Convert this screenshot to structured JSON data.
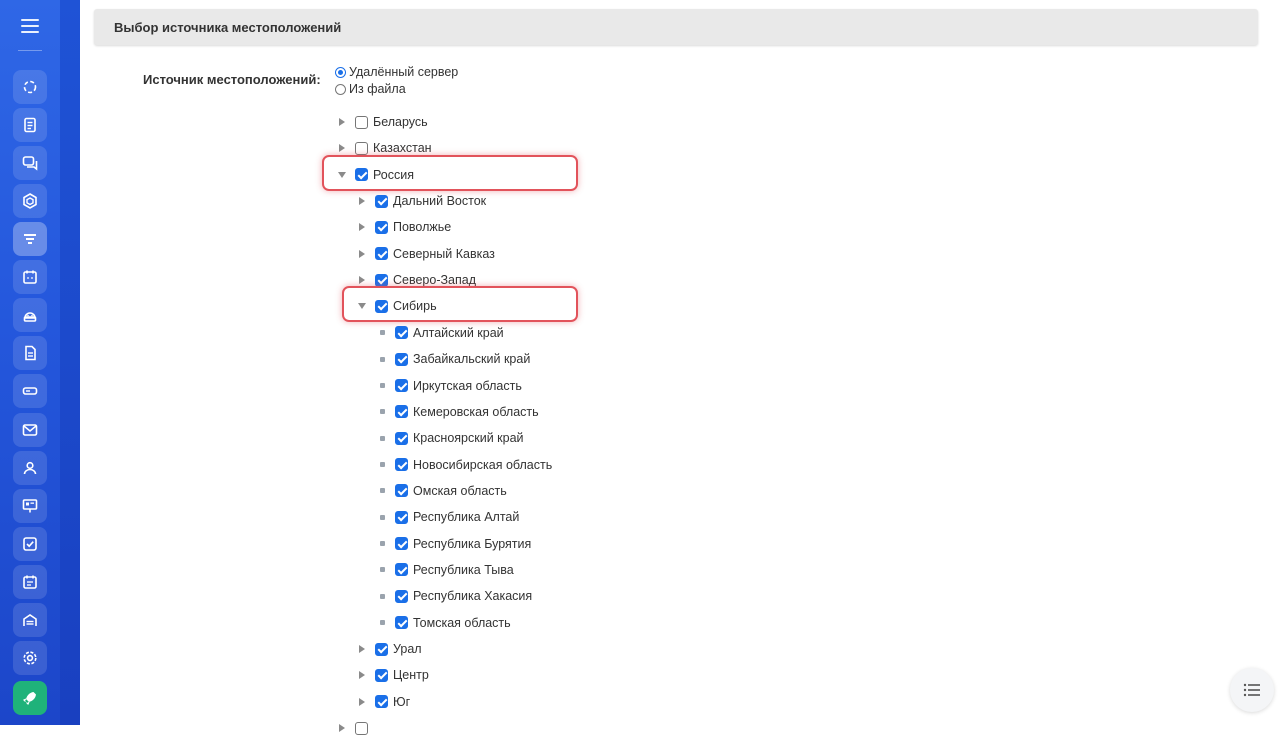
{
  "sidebar": {
    "items": [
      {
        "icon": "wheel-icon",
        "active": false
      },
      {
        "icon": "document-list-icon",
        "active": false
      },
      {
        "icon": "chat-icon",
        "active": false
      },
      {
        "icon": "hexagon-icon",
        "active": false
      },
      {
        "icon": "filter-icon",
        "active": true
      },
      {
        "icon": "calendar-icon",
        "active": false
      },
      {
        "icon": "android-icon",
        "active": false
      },
      {
        "icon": "file-icon",
        "active": false
      },
      {
        "icon": "storage-icon",
        "active": false
      },
      {
        "icon": "mail-icon",
        "active": false
      },
      {
        "icon": "users-icon",
        "active": false
      },
      {
        "icon": "presentation-icon",
        "active": false
      },
      {
        "icon": "checkbox-icon",
        "active": false
      },
      {
        "icon": "schedule-icon",
        "active": false
      },
      {
        "icon": "garage-icon",
        "active": false
      },
      {
        "icon": "gear-icon",
        "active": false
      },
      {
        "icon": "rocket-icon",
        "active": false
      }
    ]
  },
  "section": {
    "title": "Выбор источника местоположений"
  },
  "source": {
    "label": "Источник местоположений:",
    "options": [
      {
        "label": "Удалённый сервер",
        "selected": true
      },
      {
        "label": "Из файла",
        "selected": false
      }
    ]
  },
  "tree": [
    {
      "label": "Беларусь",
      "level": 0,
      "expander": "collapsed",
      "checked": false
    },
    {
      "label": "Казахстан",
      "level": 0,
      "expander": "collapsed",
      "checked": false
    },
    {
      "label": "Россия",
      "level": 0,
      "expander": "expanded",
      "checked": true,
      "highlight": true
    },
    {
      "label": "Дальний Восток",
      "level": 1,
      "expander": "collapsed",
      "checked": true
    },
    {
      "label": "Поволжье",
      "level": 1,
      "expander": "collapsed",
      "checked": true
    },
    {
      "label": "Северный Кавказ",
      "level": 1,
      "expander": "collapsed",
      "checked": true
    },
    {
      "label": "Северо-Запад",
      "level": 1,
      "expander": "collapsed",
      "checked": true
    },
    {
      "label": "Сибирь",
      "level": 1,
      "expander": "expanded",
      "checked": true,
      "highlight": true
    },
    {
      "label": "Алтайский край",
      "level": 2,
      "expander": "leaf",
      "checked": true
    },
    {
      "label": "Забайкальский край",
      "level": 2,
      "expander": "leaf",
      "checked": true
    },
    {
      "label": "Иркутская область",
      "level": 2,
      "expander": "leaf",
      "checked": true
    },
    {
      "label": "Кемеровская область",
      "level": 2,
      "expander": "leaf",
      "checked": true
    },
    {
      "label": "Красноярский край",
      "level": 2,
      "expander": "leaf",
      "checked": true
    },
    {
      "label": "Новосибирская область",
      "level": 2,
      "expander": "leaf",
      "checked": true
    },
    {
      "label": "Омская область",
      "level": 2,
      "expander": "leaf",
      "checked": true
    },
    {
      "label": "Республика Алтай",
      "level": 2,
      "expander": "leaf",
      "checked": true
    },
    {
      "label": "Республика Бурятия",
      "level": 2,
      "expander": "leaf",
      "checked": true
    },
    {
      "label": "Республика Тыва",
      "level": 2,
      "expander": "leaf",
      "checked": true
    },
    {
      "label": "Республика Хакасия",
      "level": 2,
      "expander": "leaf",
      "checked": true
    },
    {
      "label": "Томская область",
      "level": 2,
      "expander": "leaf",
      "checked": true
    },
    {
      "label": "Урал",
      "level": 1,
      "expander": "collapsed",
      "checked": true
    },
    {
      "label": "Центр",
      "level": 1,
      "expander": "collapsed",
      "checked": true
    },
    {
      "label": "Юг",
      "level": 1,
      "expander": "collapsed",
      "checked": true
    },
    {
      "label": "",
      "level": 0,
      "expander": "collapsed",
      "checked": false
    }
  ],
  "colors": {
    "sidebar": "#2457dc",
    "accent": "#1a6fe8",
    "highlight": "#e2535b",
    "launch": "#1fb27a"
  },
  "fab": {
    "icon": "list-icon"
  }
}
